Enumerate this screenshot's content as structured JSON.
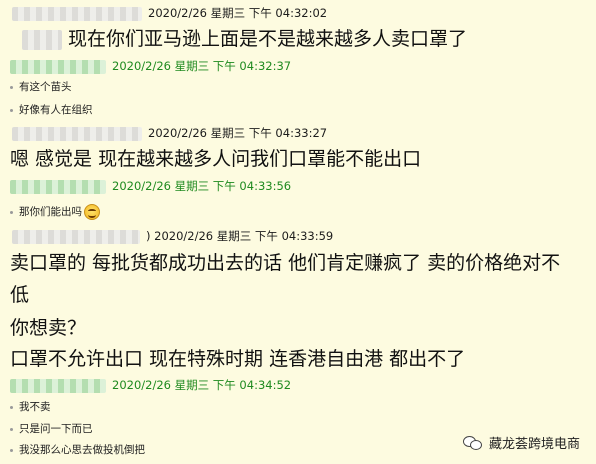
{
  "messages": [
    {
      "side": "them",
      "time": "2020/2/26 星期三 下午 04:32:02",
      "lines": [
        "现在你们亚马逊上面是不是越来越多人卖口罩了"
      ]
    },
    {
      "side": "me",
      "time": "2020/2/26 星期三 下午 04:32:37",
      "lines": [
        "有这个苗头",
        "好像有人在组织"
      ]
    },
    {
      "side": "them",
      "time": "2020/2/26 星期三 下午 04:33:27",
      "lines": [
        "嗯 感觉是  现在越来越多人问我们口罩能不能出口"
      ]
    },
    {
      "side": "me",
      "time": "2020/2/26 星期三 下午 04:33:56",
      "lines": [
        "那你们能出吗"
      ]
    },
    {
      "side": "them",
      "time": ") 2020/2/26 星期三 下午 04:33:59",
      "lines": [
        "卖口罩的 每批货都成功出去的话  他们肯定赚疯了   卖的价格绝对不",
        "低",
        "你想卖？",
        "口罩不允许出口  现在特殊时期  连香港自由港 都出不了"
      ]
    },
    {
      "side": "me",
      "time": "2020/2/26 星期三 下午 04:34:52",
      "lines": [
        "我不卖",
        "只是问一下而已",
        "我没那么心思去做投机倒把"
      ]
    }
  ],
  "watermark": {
    "text": "藏龙荟跨境电商",
    "icon": "wechat-icon"
  },
  "colors": {
    "background": "#fdfbe0",
    "my_header": "#1f8a1f",
    "their_header": "#1c1c1c"
  },
  "emoji": "smile-emoji"
}
